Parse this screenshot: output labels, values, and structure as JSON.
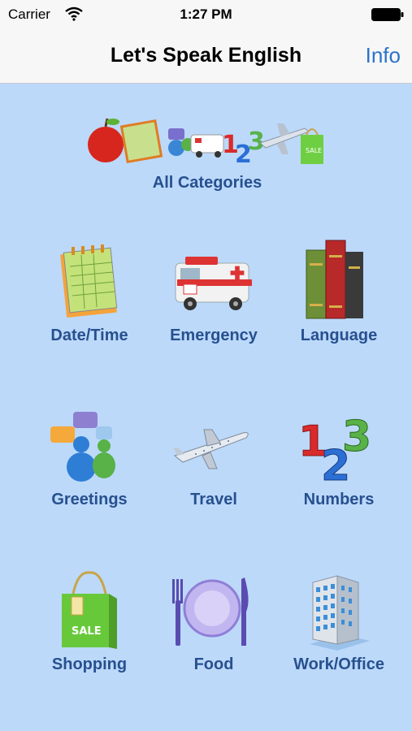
{
  "status": {
    "carrier": "Carrier",
    "time": "1:27 PM"
  },
  "nav": {
    "title": "Let's Speak English",
    "info": "Info"
  },
  "all_categories": {
    "label": "All Categories"
  },
  "categories": [
    {
      "label": "Date/Time",
      "icon": "calendar-icon"
    },
    {
      "label": "Emergency",
      "icon": "ambulance-icon"
    },
    {
      "label": "Language",
      "icon": "books-icon"
    },
    {
      "label": "Greetings",
      "icon": "people-chat-icon"
    },
    {
      "label": "Travel",
      "icon": "airplane-icon"
    },
    {
      "label": "Numbers",
      "icon": "numbers-icon"
    },
    {
      "label": "Shopping",
      "icon": "shopping-bag-icon"
    },
    {
      "label": "Food",
      "icon": "plate-fork-knife-icon"
    },
    {
      "label": "Work/Office",
      "icon": "office-building-icon"
    }
  ],
  "colors": {
    "background": "#bcd9fa",
    "label": "#27508f",
    "accent": "#2b73c8"
  }
}
